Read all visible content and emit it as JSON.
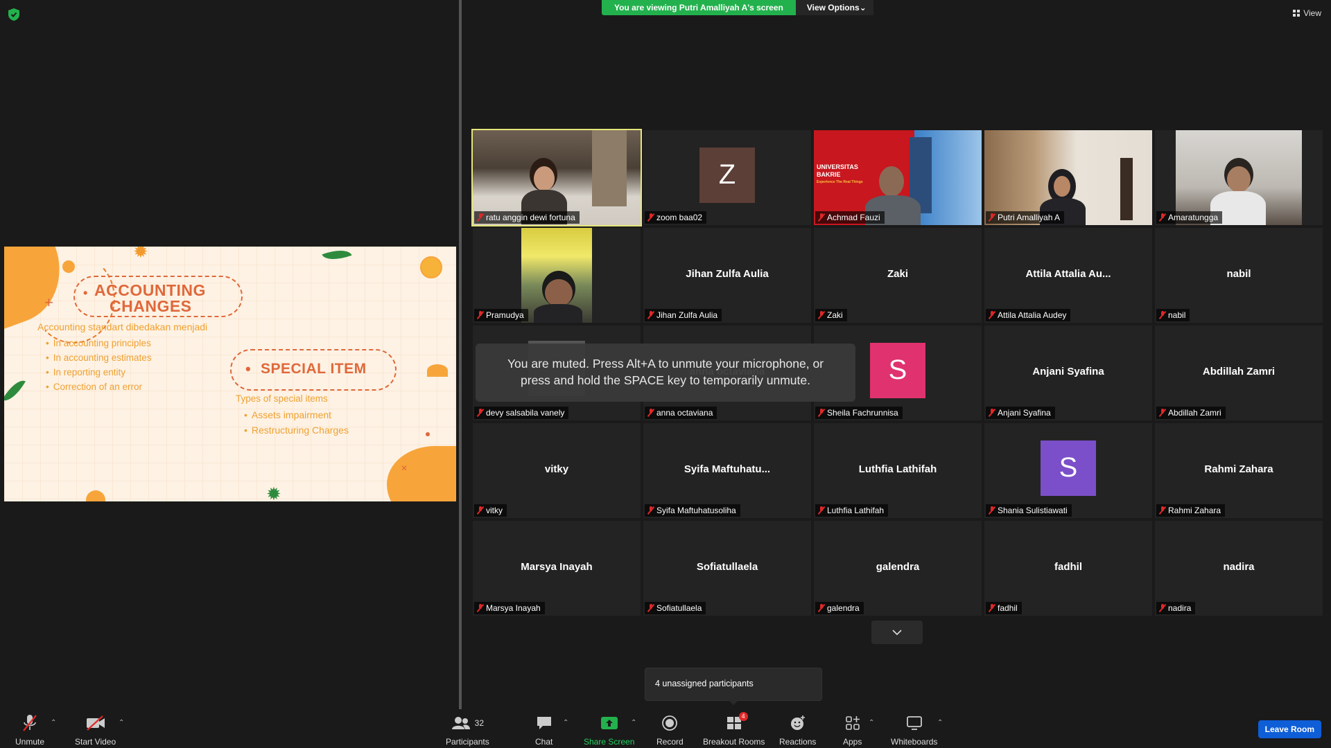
{
  "top": {
    "banner": "You are viewing Putri Amalliyah A's screen",
    "view_options": "View Options",
    "view": "View"
  },
  "slide": {
    "title1_line1": "ACCOUNTING",
    "title1_line2": "CHANGES",
    "subtitle1": "Accounting standart dibedakan menjadi",
    "bullets1": [
      "In accounting principles",
      "In accounting estimates",
      "In reporting entity",
      "Correction of an error"
    ],
    "title2": "SPECIAL ITEM",
    "subtitle2": "Types of special items",
    "bullets2": [
      "Assets impairment",
      "Restructuring Charges"
    ]
  },
  "tiles": [
    {
      "name": "ratu anggin dewi fortuna",
      "type": "video",
      "active": true
    },
    {
      "name": "zoom baa02",
      "type": "avatar",
      "letter": "Z",
      "color": "#5c3f37"
    },
    {
      "name": "Achmad Fauzi",
      "type": "video",
      "bg_text_1": "UNIVERSITAS",
      "bg_text_2": "BAKRIE",
      "bg_text_3": "Experience The Real Things"
    },
    {
      "name": "Putri Amalliyah A",
      "type": "video"
    },
    {
      "name": "Amaratungga",
      "type": "video"
    },
    {
      "name": "Pramudya",
      "type": "video"
    },
    {
      "name": "Jihan Zulfa Aulia",
      "display": "Jihan Zulfa Aulia",
      "type": "name"
    },
    {
      "name": "Zaki",
      "display": "Zaki",
      "type": "name"
    },
    {
      "name": "Attila Attalia Audey",
      "display": "Attila Attalia Au...",
      "type": "name"
    },
    {
      "name": "nabil",
      "display": "nabil",
      "type": "name"
    },
    {
      "name": "devy salsabila vanely",
      "type": "video"
    },
    {
      "name": "anna octaviana",
      "display": "anna octaviana",
      "type": "name"
    },
    {
      "name": "Sheila Fachrunnisa",
      "type": "avatar",
      "letter": "S",
      "color": "#e0326e"
    },
    {
      "name": "Anjani Syafina",
      "display": "Anjani Syafina",
      "type": "name"
    },
    {
      "name": "Abdillah Zamri",
      "display": "Abdillah Zamri",
      "type": "name"
    },
    {
      "name": "vitky",
      "display": "vitky",
      "type": "name"
    },
    {
      "name": "Syifa Maftuhatusoliha",
      "display": "Syifa  Maftuhatu...",
      "type": "name"
    },
    {
      "name": "Luthfia Lathifah",
      "display": "Luthfia Lathifah",
      "type": "name"
    },
    {
      "name": "Shania Sulistiawati",
      "type": "avatar",
      "letter": "S",
      "color": "#7b4fc9"
    },
    {
      "name": "Rahmi Zahara",
      "display": "Rahmi Zahara",
      "type": "name"
    },
    {
      "name": "Marsya Inayah",
      "display": "Marsya Inayah",
      "type": "name"
    },
    {
      "name": "Sofiatullaela",
      "display": "Sofiatullaela",
      "type": "name"
    },
    {
      "name": "galendra",
      "display": "galendra",
      "type": "name"
    },
    {
      "name": "fadhil",
      "display": "fadhil",
      "type": "name"
    },
    {
      "name": "nadira",
      "display": "nadira",
      "type": "name"
    }
  ],
  "toast": {
    "line1": "You are muted. Press Alt+A to unmute your microphone, or",
    "line2": "press and hold the SPACE key to temporarily unmute."
  },
  "tooltip": "4 unassigned participants",
  "toolbar": {
    "unmute": "Unmute",
    "start_video": "Start Video",
    "participants": "Participants",
    "participants_count": "32",
    "chat": "Chat",
    "share_screen": "Share Screen",
    "record": "Record",
    "breakout_rooms": "Breakout Rooms",
    "breakout_badge": "4",
    "reactions": "Reactions",
    "apps": "Apps",
    "whiteboards": "Whiteboards",
    "leave_room": "Leave Room"
  },
  "colors": {
    "accent_green": "#23b14d",
    "leave_blue": "#0e5ed7",
    "active_speaker": "#e6e67a",
    "muted_red": "#e02828"
  }
}
